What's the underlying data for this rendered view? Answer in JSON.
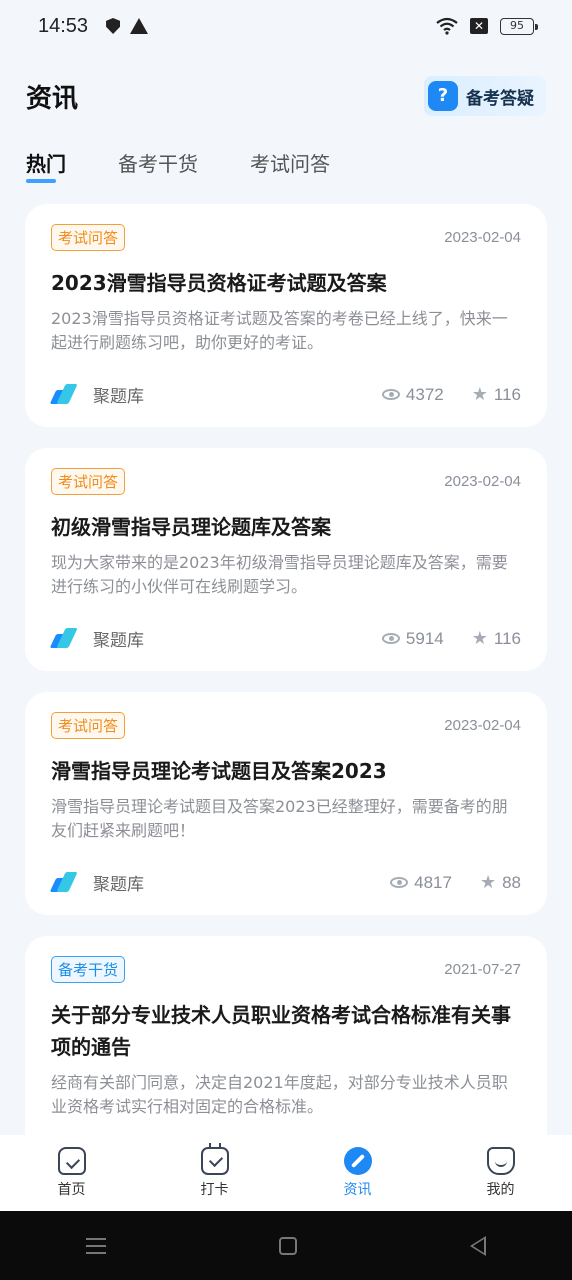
{
  "status_bar": {
    "time": "14:53",
    "battery": "95",
    "icons": [
      "shield-icon",
      "warning-icon",
      "wifi-icon",
      "x-icon",
      "battery-icon"
    ]
  },
  "header": {
    "title": "资讯",
    "qa_button_label": "备考答疑",
    "qa_icon_glyph": "?"
  },
  "tabs": [
    {
      "label": "热门",
      "active": true
    },
    {
      "label": "备考干货",
      "active": false
    },
    {
      "label": "考试问答",
      "active": false
    }
  ],
  "articles": [
    {
      "tag": "考试问答",
      "tag_color": "orange",
      "date": "2023-02-04",
      "title": "2023滑雪指导员资格证考试题及答案",
      "desc": "2023滑雪指导员资格证考试题及答案的考卷已经上线了，快来一起进行刷题练习吧，助你更好的考证。",
      "source": "聚题库",
      "views": "4372",
      "stars": "116"
    },
    {
      "tag": "考试问答",
      "tag_color": "orange",
      "date": "2023-02-04",
      "title": "初级滑雪指导员理论题库及答案",
      "desc": "现为大家带来的是2023年初级滑雪指导员理论题库及答案，需要进行练习的小伙伴可在线刷题学习。",
      "source": "聚题库",
      "views": "5914",
      "stars": "116"
    },
    {
      "tag": "考试问答",
      "tag_color": "orange",
      "date": "2023-02-04",
      "title": "滑雪指导员理论考试题目及答案2023",
      "desc": "滑雪指导员理论考试题目及答案2023已经整理好，需要备考的朋友们赶紧来刷题吧！",
      "source": "聚题库",
      "views": "4817",
      "stars": "88"
    },
    {
      "tag": "备考干货",
      "tag_color": "blue",
      "date": "2021-07-27",
      "title": "关于部分专业技术人员职业资格考试合格标准有关事项的通告",
      "desc": "经商有关部门同意，决定自2021年度起，对部分专业技术人员职业资格考试实行相对固定的合格标准。"
    }
  ],
  "bottom_nav": [
    {
      "label": "首页",
      "icon": "home-icon"
    },
    {
      "label": "打卡",
      "icon": "calendar-check-icon"
    },
    {
      "label": "资讯",
      "icon": "compass-icon",
      "active": true
    },
    {
      "label": "我的",
      "icon": "profile-icon"
    }
  ],
  "colors": {
    "accent": "#1e88f5",
    "tag_orange": "#f08c1b",
    "tag_blue": "#1d8ee6",
    "background": "#f3f6fb"
  }
}
